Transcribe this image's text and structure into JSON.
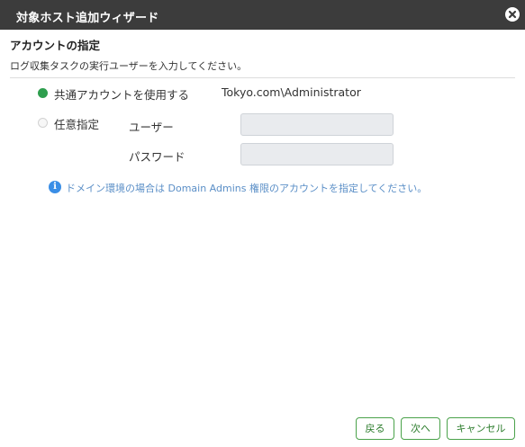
{
  "window": {
    "title": "対象ホスト追加ウィザード",
    "close_icon": "close-circle-icon"
  },
  "section": {
    "heading": "アカウントの指定",
    "description": "ログ収集タスクの実行ユーザーを入力してください。"
  },
  "options": {
    "shared_label": "共通アカウントを使用する",
    "shared_account": "Tokyo.com\\Administrator",
    "shared_selected": true,
    "custom_label": "任意指定",
    "custom_selected": false
  },
  "fields": {
    "user_label": "ユーザー",
    "user_value": "",
    "password_label": "パスワード",
    "password_value": ""
  },
  "info": {
    "icon": "info-icon",
    "text": "ドメイン環境の場合は Domain Admins 権限のアカウントを指定してください。"
  },
  "buttons": {
    "back": "戻る",
    "next": "次へ",
    "cancel": "キャンセル"
  },
  "colors": {
    "titlebar": "#3c3c3c",
    "radio_selected": "#2e9e4e",
    "info": "#3a8ee6",
    "button_border": "#4aa24a"
  }
}
